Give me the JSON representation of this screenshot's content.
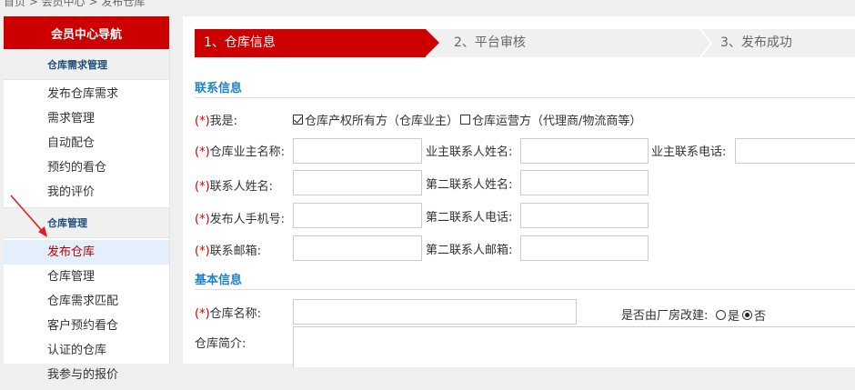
{
  "breadcrumb": "首页 > 会员中心 > 发布仓库",
  "sidebar": {
    "title": "会员中心导航",
    "groups": [
      {
        "title": "仓库需求管理",
        "items": [
          "发布仓库需求",
          "需求管理",
          "自动配仓",
          "预约的看仓",
          "我的评价"
        ]
      },
      {
        "title": "仓库管理",
        "items": [
          "发布仓库",
          "仓库管理",
          "仓库需求匹配",
          "客户预约看仓",
          "认证的仓库",
          "我参与的报价"
        ]
      }
    ],
    "active_item": "发布仓库"
  },
  "steps": [
    "1、仓库信息",
    "2、平台审核",
    "3、发布成功"
  ],
  "contact": {
    "section_title": "联系信息",
    "required_mark": "(*)",
    "i_am_label": "我是:",
    "identity_options": [
      {
        "label": "仓库产权所有方（仓库业主）",
        "checked": true
      },
      {
        "label": "仓库运营方（代理商/物流商等）",
        "checked": false
      }
    ],
    "owner_name_label": "仓库业主名称:",
    "owner_contact_name_label": "业主联系人姓名:",
    "owner_contact_phone_label": "业主联系电话:",
    "contact_name_label": "联系人姓名:",
    "second_contact_name_label": "第二联系人姓名:",
    "publisher_mobile_label": "发布人手机号:",
    "second_contact_phone_label": "第二联系人电话:",
    "email_label": "联系邮箱:",
    "second_contact_email_label": "第二联系人邮箱:"
  },
  "basic": {
    "section_title": "基本信息",
    "warehouse_name_label": "仓库名称:",
    "factory_converted_label": "是否由厂房改建:",
    "factory_options": [
      {
        "label": "是",
        "selected": false
      },
      {
        "label": "否",
        "selected": true
      }
    ],
    "intro_label": "仓库简介:"
  },
  "colors": {
    "accent": "#cc0000",
    "section": "#1e82c8",
    "active_bg": "#e3f0fb"
  }
}
